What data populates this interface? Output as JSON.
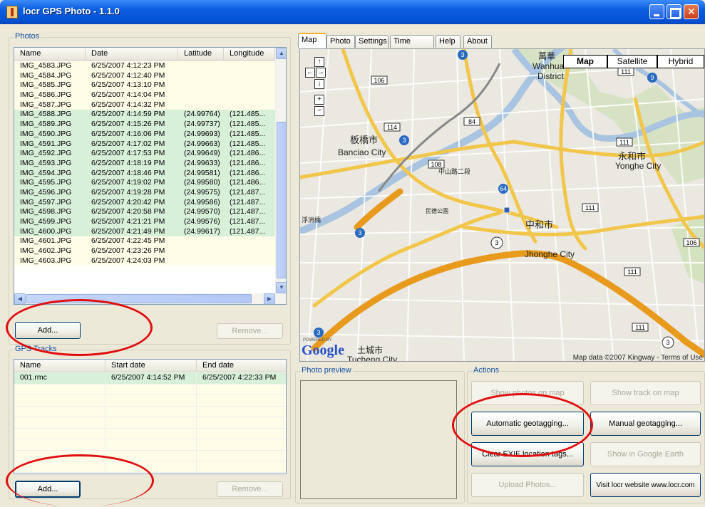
{
  "window": {
    "title": "locr GPS Photo - 1.1.0"
  },
  "photos": {
    "group_label": "Photos",
    "columns": [
      "Name",
      "Date",
      "Latitude",
      "Longitude"
    ],
    "rows": [
      {
        "name": "IMG_4583.JPG",
        "date": "6/25/2007 4:12:23 PM",
        "lat": "",
        "lon": "",
        "tagged": false
      },
      {
        "name": "IMG_4584.JPG",
        "date": "6/25/2007 4:12:40 PM",
        "lat": "",
        "lon": "",
        "tagged": false
      },
      {
        "name": "IMG_4585.JPG",
        "date": "6/25/2007 4:13:10 PM",
        "lat": "",
        "lon": "",
        "tagged": false
      },
      {
        "name": "IMG_4586.JPG",
        "date": "6/25/2007 4:14:04 PM",
        "lat": "",
        "lon": "",
        "tagged": false
      },
      {
        "name": "IMG_4587.JPG",
        "date": "6/25/2007 4:14:32 PM",
        "lat": "",
        "lon": "",
        "tagged": false
      },
      {
        "name": "IMG_4588.JPG",
        "date": "6/25/2007 4:14:59 PM",
        "lat": "(24.99764)",
        "lon": "(121.485...",
        "tagged": true
      },
      {
        "name": "IMG_4589.JPG",
        "date": "6/25/2007 4:15:26 PM",
        "lat": "(24.99737)",
        "lon": "(121.485...",
        "tagged": true
      },
      {
        "name": "IMG_4590.JPG",
        "date": "6/25/2007 4:16:06 PM",
        "lat": "(24.99693)",
        "lon": "(121.485...",
        "tagged": true
      },
      {
        "name": "IMG_4591.JPG",
        "date": "6/25/2007 4:17:02 PM",
        "lat": "(24.99663)",
        "lon": "(121.485...",
        "tagged": true
      },
      {
        "name": "IMG_4592.JPG",
        "date": "6/25/2007 4:17:53 PM",
        "lat": "(24.99649)",
        "lon": "(121.486...",
        "tagged": true
      },
      {
        "name": "IMG_4593.JPG",
        "date": "6/25/2007 4:18:19 PM",
        "lat": "(24.99633)",
        "lon": "(121.486...",
        "tagged": true
      },
      {
        "name": "IMG_4594.JPG",
        "date": "6/25/2007 4:18:46 PM",
        "lat": "(24.99581)",
        "lon": "(121.486...",
        "tagged": true
      },
      {
        "name": "IMG_4595.JPG",
        "date": "6/25/2007 4:19:02 PM",
        "lat": "(24.99580)",
        "lon": "(121.486...",
        "tagged": true
      },
      {
        "name": "IMG_4596.JPG",
        "date": "6/25/2007 4:19:28 PM",
        "lat": "(24.99575)",
        "lon": "(121.487...",
        "tagged": true
      },
      {
        "name": "IMG_4597.JPG",
        "date": "6/25/2007 4:20:42 PM",
        "lat": "(24.99586)",
        "lon": "(121.487...",
        "tagged": true
      },
      {
        "name": "IMG_4598.JPG",
        "date": "6/25/2007 4:20:58 PM",
        "lat": "(24.99570)",
        "lon": "(121.487...",
        "tagged": true
      },
      {
        "name": "IMG_4599.JPG",
        "date": "6/25/2007 4:21:21 PM",
        "lat": "(24.99576)",
        "lon": "(121.487...",
        "tagged": true
      },
      {
        "name": "IMG_4600.JPG",
        "date": "6/25/2007 4:21:49 PM",
        "lat": "(24.99617)",
        "lon": "(121.487...",
        "tagged": true
      },
      {
        "name": "IMG_4601.JPG",
        "date": "6/25/2007 4:22:45 PM",
        "lat": "",
        "lon": "",
        "tagged": false
      },
      {
        "name": "IMG_4602.JPG",
        "date": "6/25/2007 4:23:26 PM",
        "lat": "",
        "lon": "",
        "tagged": false
      },
      {
        "name": "IMG_4603.JPG",
        "date": "6/25/2007 4:24:03 PM",
        "lat": "",
        "lon": "",
        "tagged": false
      }
    ],
    "add_label": "Add...",
    "remove_label": "Remove..."
  },
  "tracks": {
    "group_label": "GPS Tracks",
    "columns": [
      "Name",
      "Start date",
      "End date"
    ],
    "rows": [
      {
        "name": "001.rmc",
        "start": "6/25/2007 4:14:52 PM",
        "end": "6/25/2007 4:22:33 PM"
      }
    ],
    "add_label": "Add...",
    "remove_label": "Remove..."
  },
  "tabs": [
    "Map",
    "Photo",
    "Settings",
    "Time Adjust",
    "Help",
    "About"
  ],
  "map": {
    "types": [
      "Map",
      "Satellite",
      "Hybrid"
    ],
    "attribution": "Map data ©2007 Kingway - Terms of Use",
    "logo": "Google",
    "powered_by": "POWERED BY",
    "labels": [
      {
        "text": "萬華",
        "id": "wanhua-zh"
      },
      {
        "text": "Wanhua",
        "id": "wanhua-en"
      },
      {
        "text": "District",
        "id": "district"
      },
      {
        "text": "板橋市",
        "id": "banciao-zh"
      },
      {
        "text": "Banciao City",
        "id": "banciao-en"
      },
      {
        "text": "永和市",
        "id": "yonghe-zh"
      },
      {
        "text": "Yonghe City",
        "id": "yonghe-en"
      },
      {
        "text": "中和市",
        "id": "jhonghe-zh"
      },
      {
        "text": "Jhonghe City",
        "id": "jhonghe-en"
      },
      {
        "text": "土城市",
        "id": "tucheng-zh"
      },
      {
        "text": "Tucheng City",
        "id": "tucheng-en"
      },
      {
        "text": "民德公園",
        "id": "park"
      },
      {
        "text": "浮洲橋",
        "id": "bridge"
      },
      {
        "text": "中山路二段",
        "id": "zhongshan"
      },
      {
        "text": "Jhonghe",
        "id": "jhonghe-short"
      }
    ],
    "shields": [
      "3",
      "106",
      "114",
      "108",
      "84",
      "111",
      "106",
      "111",
      "111",
      "3",
      "9",
      "64",
      "3"
    ]
  },
  "preview": {
    "group_label": "Photo preview"
  },
  "actions": {
    "group_label": "Actions",
    "show_photos": "Show photos on map",
    "show_track": "Show track on map",
    "auto_geotag": "Automatic geotagging...",
    "manual_geotag": "Manual geotagging...",
    "clear_exif": "Clear EXIF location tags...",
    "google_earth": "Show in Google Earth",
    "upload": "Upload Photos...",
    "visit": "Visit locr website www.locr.com"
  }
}
